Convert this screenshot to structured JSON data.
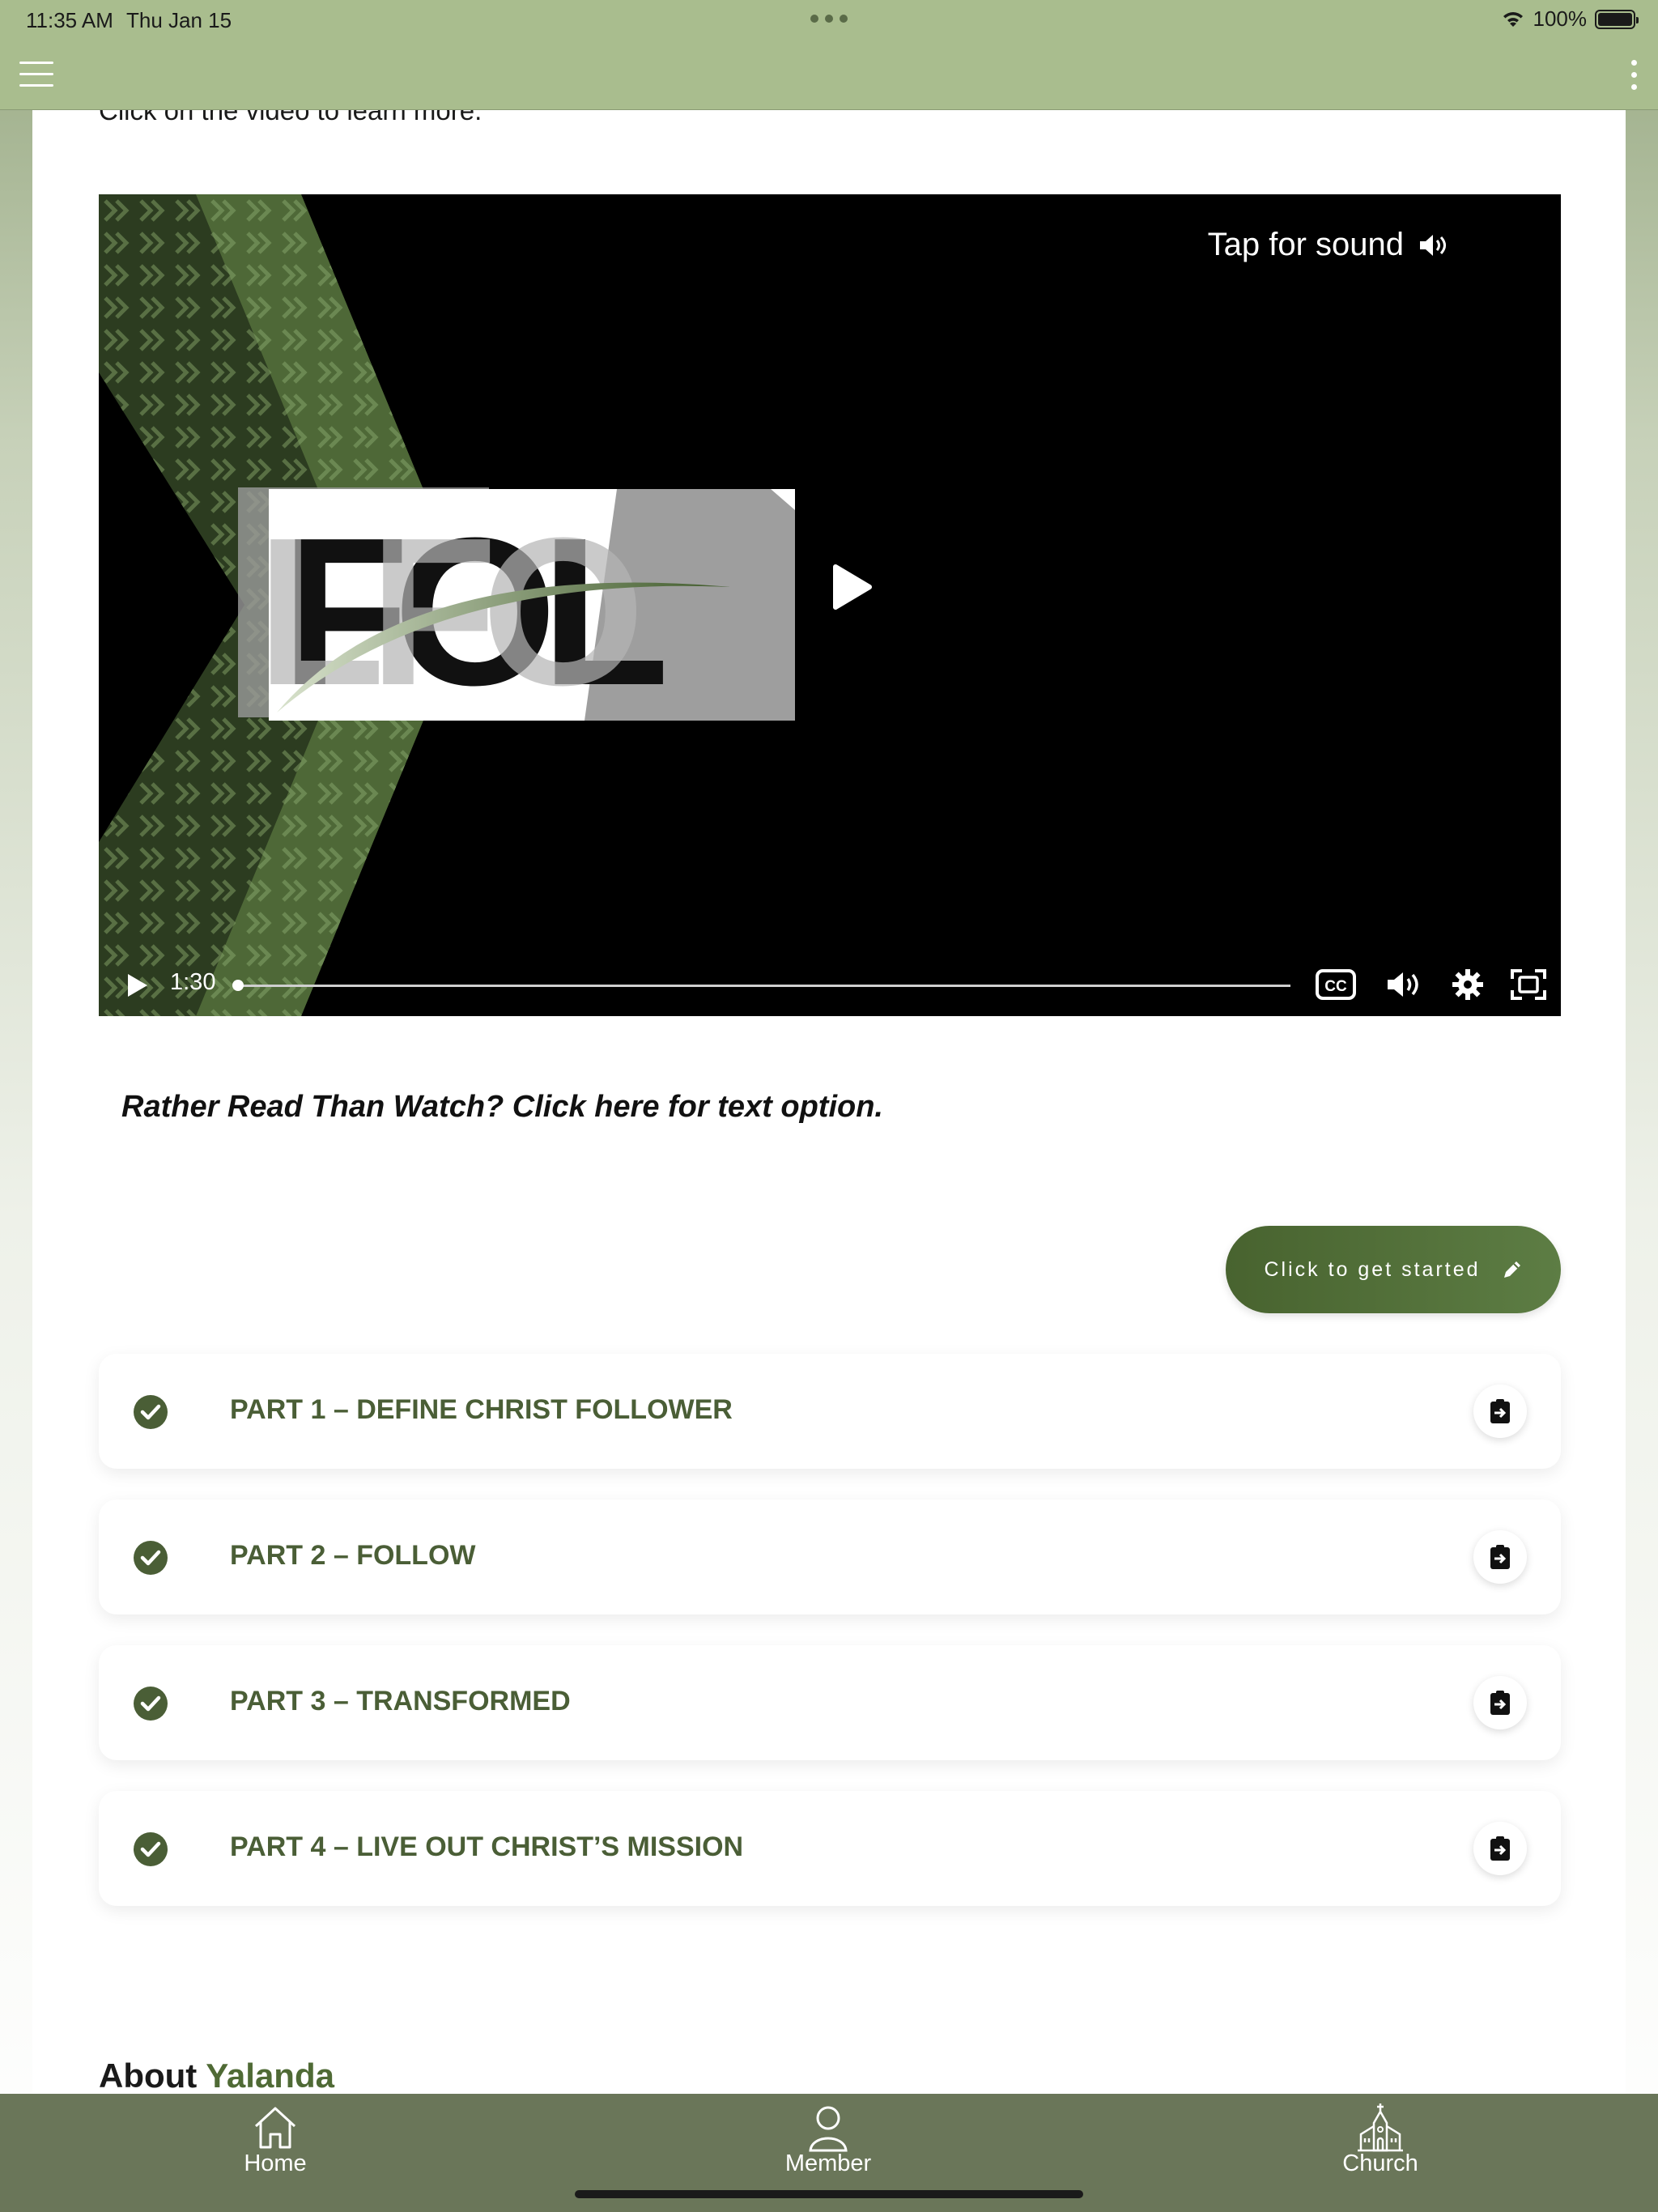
{
  "status_bar": {
    "time": "11:35 AM",
    "date": "Thu Jan 15",
    "battery": "100%"
  },
  "app_bar": {
    "menu_icon": "hamburger-icon",
    "more_icon": "kebab-icon"
  },
  "intro_text": "Click on the video to learn more.",
  "video": {
    "tap_for_sound": "Tap for sound",
    "time": "1:30",
    "progress": 0,
    "controls": [
      "play-icon",
      "closed-captions-icon",
      "volume-icon",
      "settings-icon",
      "fullscreen-icon"
    ]
  },
  "read_link": "Rather Read Than Watch? Click here for text option.",
  "start_button": "Click to get started",
  "parts": [
    {
      "title": "PART 1 – DEFINE CHRIST FOLLOWER",
      "completed": true
    },
    {
      "title": "PART 2 – FOLLOW",
      "completed": true
    },
    {
      "title": "PART 3 – TRANSFORMED",
      "completed": true
    },
    {
      "title": "PART 4 – LIVE OUT CHRIST’S MISSION",
      "completed": true
    }
  ],
  "about": {
    "prefix": "About",
    "name": "Yalanda"
  },
  "tabs": [
    {
      "label": "Home",
      "icon": "home-icon"
    },
    {
      "label": "Member",
      "icon": "member-icon"
    },
    {
      "label": "Church",
      "icon": "church-icon"
    }
  ],
  "colors": {
    "header": "#a9bd8e",
    "accent": "#4a5e36",
    "tab_bar": "#6a7659",
    "button": "#4f6a35"
  }
}
